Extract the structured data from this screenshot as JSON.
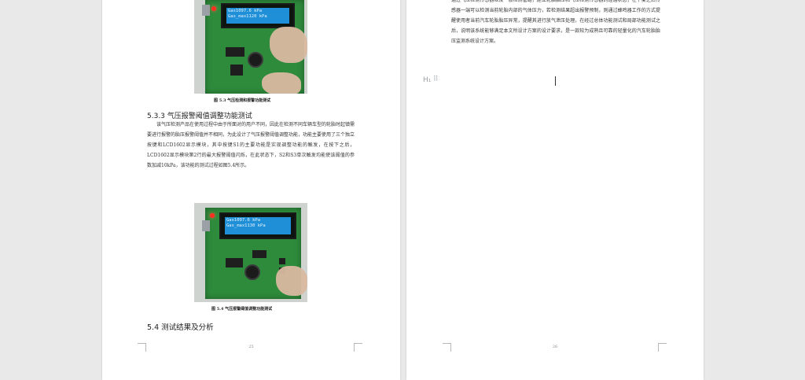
{
  "left_page": {
    "figure_3": {
      "lcd_line1": "Gas1097.6 kPa",
      "lcd_line2": "Gas_max1120 kPa",
      "caption": "图 5.3  气压检测和报警功能测试"
    },
    "section_heading": "5.3.3 气压报警阈值调整功能测试",
    "paragraph": "该气压检测产品在使用过程中由于所面对的用户不同，因此在检测不同车辆车型的轮胎时起镇需要进行报警的胎压报警阈值并不相同，为此设计了气压报警阈值调整功能，功能主要使用了三个独立按键和LCD1602显示模块，其中按键S1的主要功能是实现调整功能的触发，在按下之后，LCD1602显示模块第2行的最大报警阈值闪烁，在此状态下，S2和S3单次触发均能使该阈值的参数加减10kPa，该功能的测试过程如图5.4所示。",
    "figure_4": {
      "lcd_line1": "Gas1097.6 kPa",
      "lcd_line2": "Gas_max1130 kPa",
      "caption": "图 5.4  气压报警阈值调整功能测试"
    },
    "section_heading_2": "5.4  测试结果及分析",
    "page_number": "25"
  },
  "right_page": {
    "paragraph": "通过气压检测传感器以及一般检测管路，建立轮胎胎压和气压检测传感器的连通状态，在平衡之后传感器一端可以检测当前轮胎内部的气体压力，若检测结果超出报警预制，则通过蜂鸣器工作的方式提醒使用者当前汽车轮胎胎压异常，提醒其进行放气泄压处理。在经过总体功能测试和局部功能测试之后，说明该系统能够满足本文所设计方案的设计要求，是一款较为成熟且可靠的轻量化的汽车轮胎胎压监测系统设计方案。",
    "heading_marker": "H₁",
    "page_number": "26"
  }
}
